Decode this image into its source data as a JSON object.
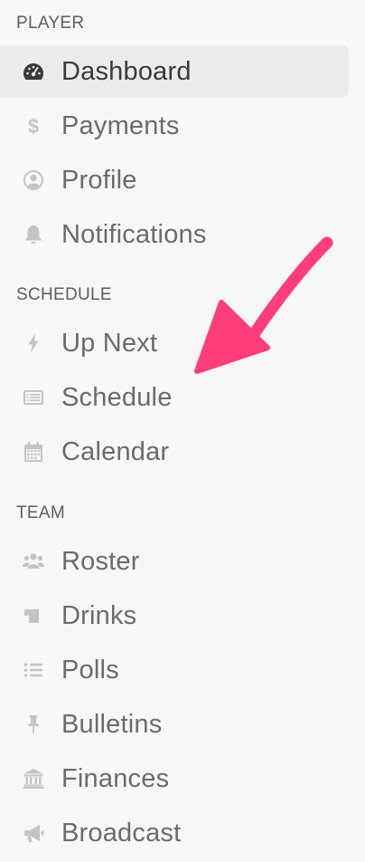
{
  "sections": [
    {
      "header": "PLAYER",
      "items": [
        {
          "label": "Dashboard",
          "icon": "dashboard-icon",
          "active": true
        },
        {
          "label": "Payments",
          "icon": "dollar-icon"
        },
        {
          "label": "Profile",
          "icon": "profile-icon"
        },
        {
          "label": "Notifications",
          "icon": "bell-icon"
        }
      ]
    },
    {
      "header": "SCHEDULE",
      "items": [
        {
          "label": "Up Next",
          "icon": "lightning-icon"
        },
        {
          "label": "Schedule",
          "icon": "list-card-icon"
        },
        {
          "label": "Calendar",
          "icon": "calendar-icon"
        }
      ]
    },
    {
      "header": "TEAM",
      "items": [
        {
          "label": "Roster",
          "icon": "group-icon"
        },
        {
          "label": "Drinks",
          "icon": "mug-icon"
        },
        {
          "label": "Polls",
          "icon": "list-icon"
        },
        {
          "label": "Bulletins",
          "icon": "pin-icon"
        },
        {
          "label": "Finances",
          "icon": "bank-icon"
        },
        {
          "label": "Broadcast",
          "icon": "megaphone-icon"
        }
      ]
    }
  ],
  "colors": {
    "background": "#f7f7f7",
    "active_background": "#ebebeb",
    "icon": "#c4c4c4",
    "active_icon": "#3a3a3a",
    "label": "#6b6b6b",
    "arrow": "#ff3d7a"
  }
}
